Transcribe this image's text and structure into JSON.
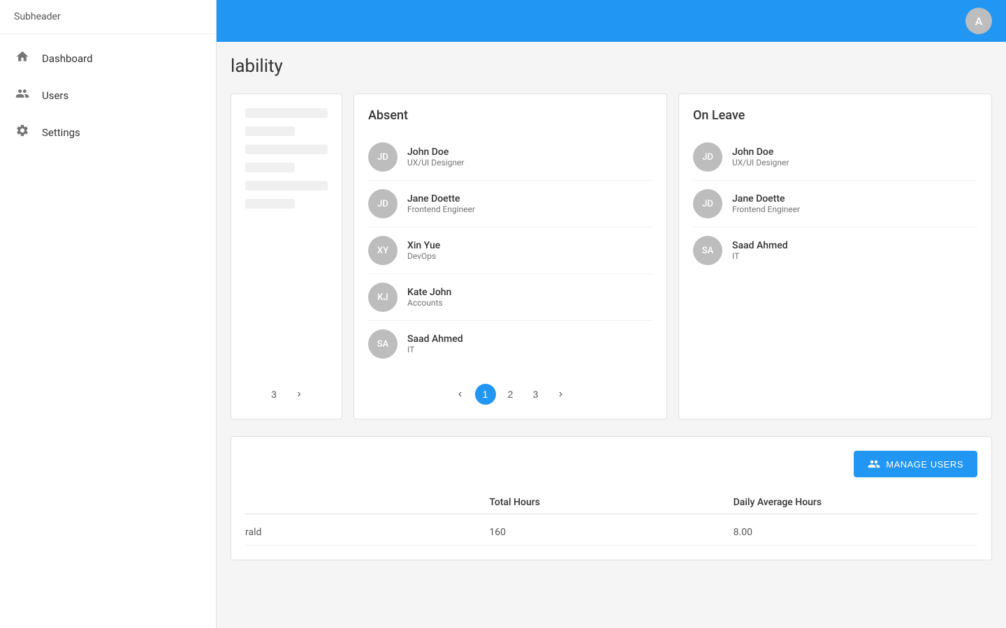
{
  "sidebar": {
    "subheader": "Subheader",
    "items": [
      {
        "id": "dashboard",
        "label": "Dashboard",
        "icon": "⌂"
      },
      {
        "id": "users",
        "label": "Users",
        "icon": "👥"
      },
      {
        "id": "settings",
        "label": "Settings",
        "icon": "⚙"
      }
    ]
  },
  "topbar": {
    "avatar_letter": "A"
  },
  "page": {
    "title": "lability"
  },
  "absent_card": {
    "title": "Absent",
    "people": [
      {
        "initials": "JD",
        "name": "John Doe",
        "role": "UX/UI Designer"
      },
      {
        "initials": "JD",
        "name": "Jane Doette",
        "role": "Frontend Engineer"
      },
      {
        "initials": "XY",
        "name": "Xin Yue",
        "role": "DevOps"
      },
      {
        "initials": "KJ",
        "name": "Kate John",
        "role": "Accounts"
      },
      {
        "initials": "SA",
        "name": "Saad Ahmed",
        "role": "IT"
      }
    ],
    "pagination": {
      "prev": "‹",
      "pages": [
        "1",
        "2",
        "3"
      ],
      "next": "›",
      "active_page": "1"
    }
  },
  "on_leave_card": {
    "title": "On Leave",
    "people": [
      {
        "initials": "JD",
        "name": "John Doe",
        "role": "UX/UI Designer"
      },
      {
        "initials": "JD",
        "name": "Jane Doette",
        "role": "Frontend Engineer"
      },
      {
        "initials": "SA",
        "name": "Saad Ahmed",
        "role": "IT"
      }
    ]
  },
  "bottom_section": {
    "manage_users_label": "MANAGE USERS",
    "table_headers": [
      "",
      "Total Hours",
      "Daily Average Hours"
    ],
    "rows": [
      {
        "name": "rald",
        "total_hours": "160",
        "daily_avg": "8.00"
      }
    ]
  },
  "left_card_pagination": {
    "pages": [
      "3"
    ],
    "next": "›"
  }
}
